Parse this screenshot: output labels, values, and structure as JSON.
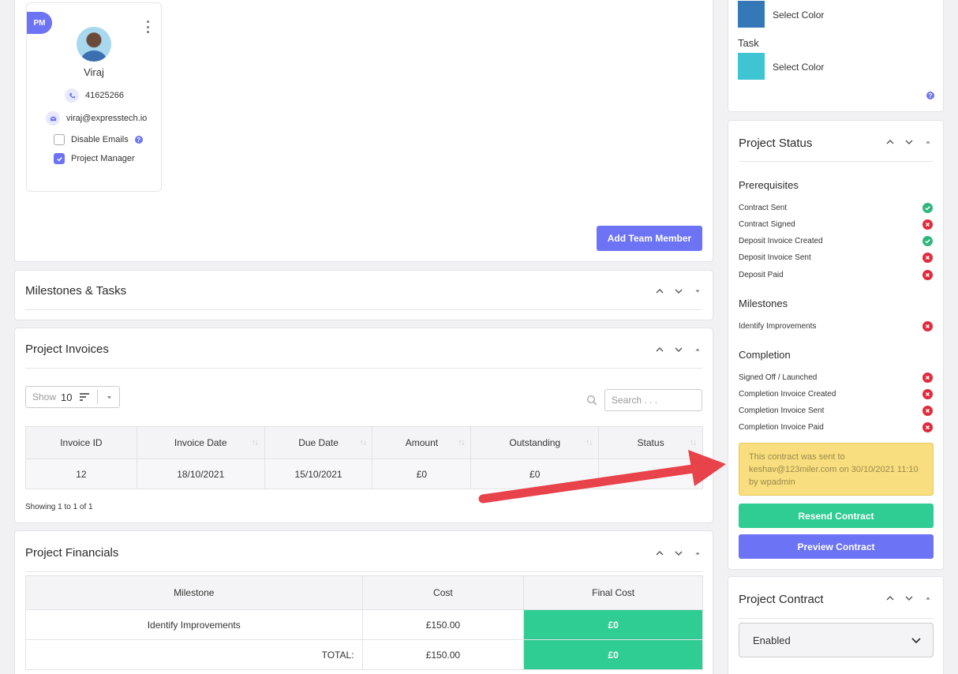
{
  "member": {
    "badge": "PM",
    "name": "Viraj",
    "phone": "41625266",
    "email": "viraj@expresstech.io",
    "disable_emails": "Disable Emails",
    "project_manager": "Project Manager"
  },
  "team": {
    "add_button": "Add Team Member"
  },
  "milestones": {
    "title": "Milestones & Tasks"
  },
  "invoices": {
    "title": "Project Invoices",
    "show_label": "Show",
    "show_value": "10",
    "search_placeholder": "Search . . .",
    "columns": [
      "Invoice ID",
      "Invoice Date",
      "Due Date",
      "Amount",
      "Outstanding",
      "Status"
    ],
    "rows": [
      [
        "12",
        "18/10/2021",
        "15/10/2021",
        "£0",
        "£0",
        ""
      ]
    ],
    "footer": "Showing 1 to 1 of 1"
  },
  "financials": {
    "title": "Project Financials",
    "columns": [
      "Milestone",
      "Cost",
      "Final Cost"
    ],
    "rows": [
      [
        "Identify Improvements",
        "£150.00",
        "£0"
      ],
      [
        "TOTAL:",
        "£150.00",
        "£0"
      ]
    ]
  },
  "colors": {
    "select_label_1": "Select Color",
    "task_label": "Task",
    "select_label_2": "Select Color",
    "swatch_1": "#3478b8",
    "swatch_2": "#3ec4d2"
  },
  "status": {
    "title": "Project Status",
    "prerequisites_head": "Prerequisites",
    "prerequisites": [
      {
        "label": "Contract Sent",
        "state": "ok"
      },
      {
        "label": "Contract Signed",
        "state": "no"
      },
      {
        "label": "Deposit Invoice Created",
        "state": "ok"
      },
      {
        "label": "Deposit Invoice Sent",
        "state": "no"
      },
      {
        "label": "Deposit Paid",
        "state": "no"
      }
    ],
    "milestones_head": "Milestones",
    "milestones": [
      {
        "label": "Identify Improvements",
        "state": "no"
      }
    ],
    "completion_head": "Completion",
    "completion": [
      {
        "label": "Signed Off / Launched",
        "state": "no"
      },
      {
        "label": "Completion Invoice Created",
        "state": "no"
      },
      {
        "label": "Completion Invoice Sent",
        "state": "no"
      },
      {
        "label": "Completion Invoice Paid",
        "state": "no"
      }
    ],
    "notice": "This contract was sent to keshav@123miler.com on 30/10/2021 11:10 by wpadmin",
    "resend": "Resend Contract",
    "preview": "Preview Contract"
  },
  "contract": {
    "title": "Project Contract",
    "select_value": "Enabled"
  },
  "palette": {
    "primary": "#6c73f5",
    "success": "#2fcc93",
    "danger": "#e02b3d",
    "notice_bg": "#f8de7e"
  }
}
